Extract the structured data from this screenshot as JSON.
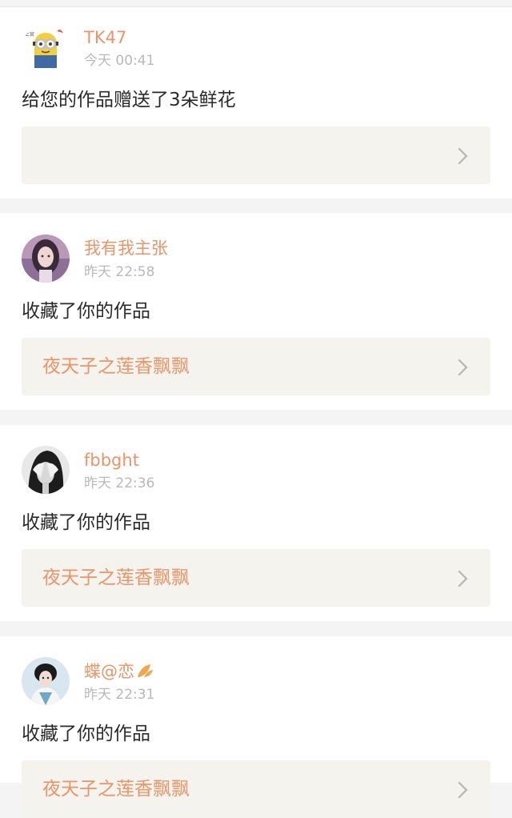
{
  "feed": [
    {
      "username": "TK47",
      "time": "今天 00:41",
      "action": "给您的作品赠送了3朵鲜花",
      "link_title": "",
      "avatar_icon": "minion-avatar-icon"
    },
    {
      "username": "我有我主张",
      "time": "昨天 22:58",
      "action": "收藏了你的作品",
      "link_title": "夜天子之莲香飘飘",
      "avatar_icon": "girl-portrait-avatar-icon"
    },
    {
      "username": "fbbght",
      "time": "昨天 22:36",
      "action": "收藏了你的作品",
      "link_title": "夜天子之莲香飘飘",
      "avatar_icon": "bw-portrait-avatar-icon"
    },
    {
      "username": "蝶@恋",
      "time": "昨天 22:31",
      "action": "收藏了你的作品",
      "link_title": "夜天子之莲香飘飘",
      "avatar_icon": "hanfu-portrait-avatar-icon"
    }
  ],
  "colors": {
    "accent": "#e8956a",
    "timestamp": "#b9b9b9",
    "card_bg": "#ffffff",
    "page_bg": "#f4f4f4",
    "link_box_bg": "#f4f3ee"
  }
}
